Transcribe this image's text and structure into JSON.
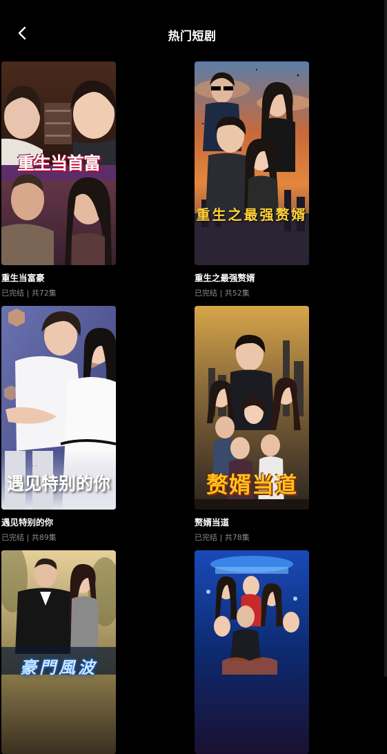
{
  "header": {
    "title": "热门短剧"
  },
  "dramas": [
    {
      "title": "重生当富豪",
      "meta": "已完结 | 共72集",
      "poster_text": "重生当首富"
    },
    {
      "title": "重生之最强赘婿",
      "meta": "已完结 | 共52集",
      "poster_text": "重生之最强赘婿"
    },
    {
      "title": "遇见特别的你",
      "meta": "已完结 | 共89集",
      "poster_text": "遇见特别的你"
    },
    {
      "title": "赘婿当道",
      "meta": "已完结 | 共78集",
      "poster_text": "赘婿当道"
    },
    {
      "poster_text": "豪門風波"
    },
    {
      "poster_text": ""
    }
  ],
  "colors": {
    "background": "#000000",
    "meta_text": "#8a8a8a",
    "title_text": "#ffffff"
  },
  "icons": {
    "back": "chevron-left-icon"
  }
}
